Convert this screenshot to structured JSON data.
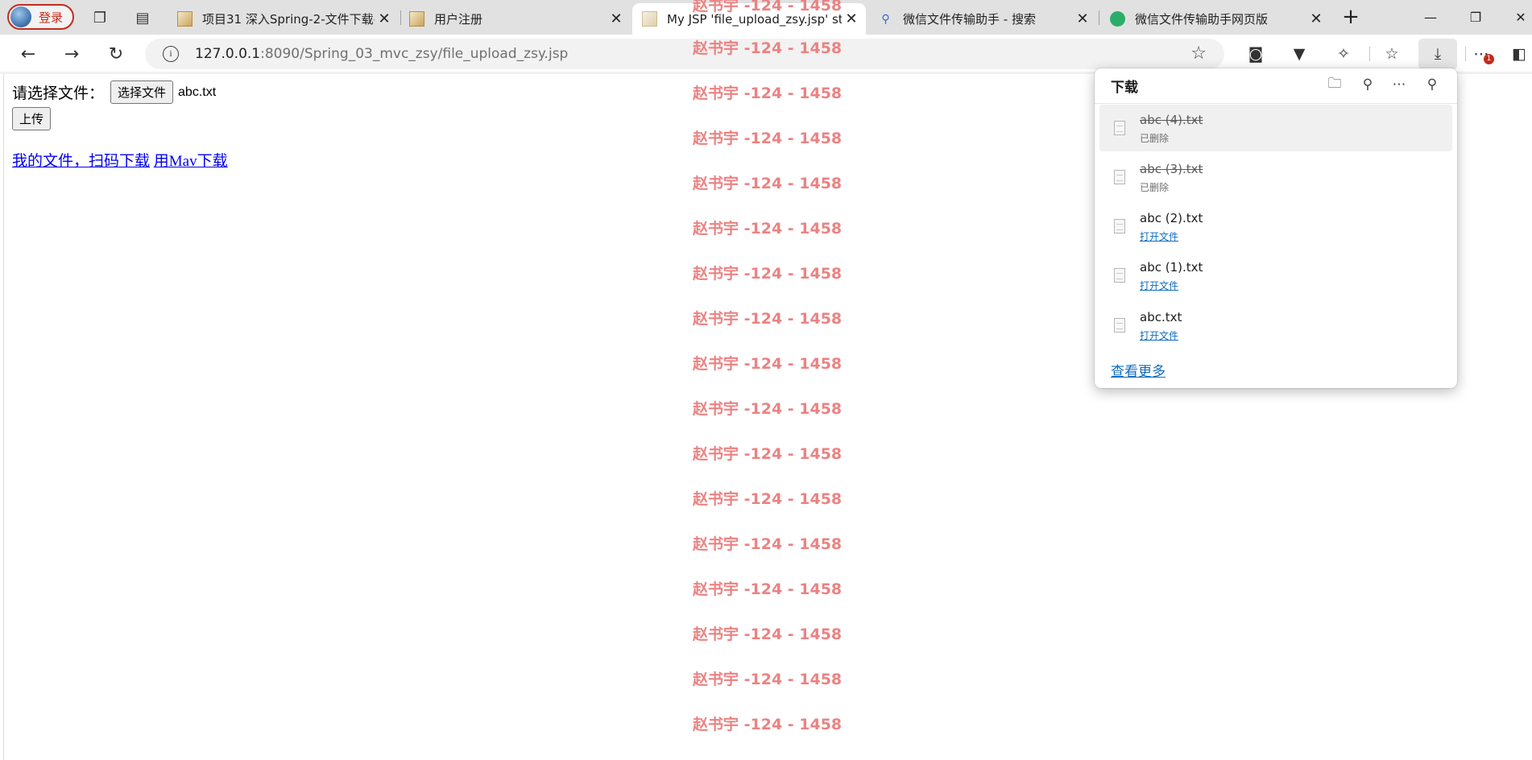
{
  "browser": {
    "profile": {
      "label": "登录"
    },
    "tabs": [
      {
        "title": "项目31 深入Spring-2-文件下载-",
        "favicon": "image-icon"
      },
      {
        "title": "用户注册",
        "favicon": "image-icon"
      },
      {
        "title": "My JSP 'file_upload_zsy.jsp' start",
        "favicon": "image-icon",
        "active": true
      },
      {
        "title": "微信文件传输助手 - 搜索",
        "favicon": "search-icon"
      },
      {
        "title": "微信文件传输助手网页版",
        "favicon": "wechat-icon"
      }
    ],
    "address": {
      "host": "127.0.0.1",
      "rest": ":8090/Spring_03_mvc_zsy/file_upload_zsy.jsp"
    },
    "extension_badge": "1",
    "accent_color": "#c42b1c"
  },
  "page": {
    "choose_label": "请选择文件：",
    "choose_button": "选择文件",
    "chosen_file": "abc.txt",
    "upload_button": "上传",
    "links": [
      "我的文件，扫码下载",
      "用Mav下载"
    ],
    "watermark": "赵书宇 -124 - 1458",
    "watermark_color": "#ec8282"
  },
  "downloads": {
    "title": "下载",
    "items": [
      {
        "name": "abc (4).txt",
        "status": "已删除",
        "deleted": true
      },
      {
        "name": "abc (3).txt",
        "status": "已删除",
        "deleted": true
      },
      {
        "name": "abc (2).txt",
        "status": "打开文件",
        "deleted": false
      },
      {
        "name": "abc (1).txt",
        "status": "打开文件",
        "deleted": false
      },
      {
        "name": "abc.txt",
        "status": "打开文件",
        "deleted": false
      }
    ],
    "see_more": "查看更多",
    "link_color": "#0f6cbd"
  }
}
